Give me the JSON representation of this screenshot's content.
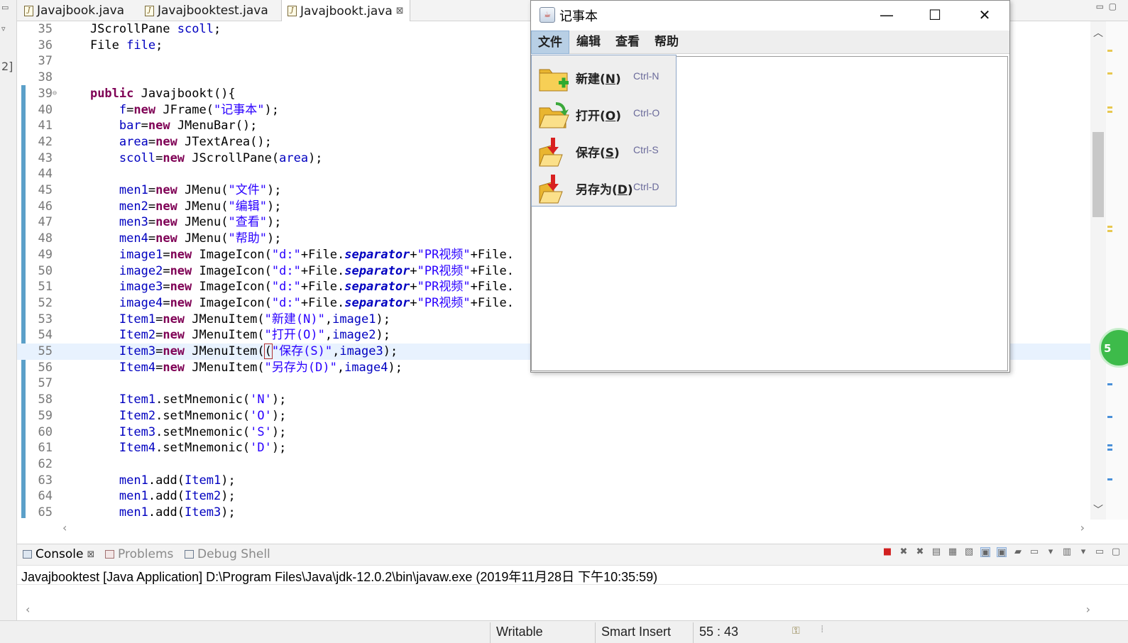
{
  "editor_tabs": [
    {
      "label": "Javajbook.java",
      "active": false
    },
    {
      "label": "Javajbooktest.java",
      "active": false
    },
    {
      "label": "Javajbookt.java",
      "active": true,
      "close": "⊠"
    }
  ],
  "left_strip": {
    "label": "2]"
  },
  "code_lines": [
    {
      "n": "35",
      "src": "    JScrollPane scoll;",
      "html": "    JScrollPane <span class=\"fld\">scoll</span>;"
    },
    {
      "n": "36",
      "src": "    File file;",
      "html": "    File <span class=\"fld\">file</span>;"
    },
    {
      "n": "37",
      "src": "",
      "html": ""
    },
    {
      "n": "38",
      "src": "",
      "html": ""
    },
    {
      "n": "39",
      "src": "    public Javajbookt(){",
      "html": "    <span class=\"kw\">public</span> Javajbookt(){",
      "fold": true
    },
    {
      "n": "40",
      "src": "        f=new JFrame(\"记事本\");",
      "html": "        <span class=\"fld\">f</span>=<span class=\"kw\">new</span> JFrame(<span class=\"str\">\"记事本\"</span>);"
    },
    {
      "n": "41",
      "src": "        bar=new JMenuBar();",
      "html": "        <span class=\"fld\">bar</span>=<span class=\"kw\">new</span> JMenuBar();"
    },
    {
      "n": "42",
      "src": "        area=new JTextArea();",
      "html": "        <span class=\"fld\">area</span>=<span class=\"kw\">new</span> JTextArea();"
    },
    {
      "n": "43",
      "src": "        scoll=new JScrollPane(area);",
      "html": "        <span class=\"fld\">scoll</span>=<span class=\"kw\">new</span> JScrollPane(<span class=\"fld\">area</span>);"
    },
    {
      "n": "44",
      "src": "",
      "html": ""
    },
    {
      "n": "45",
      "src": "        men1=new JMenu(\"文件\");",
      "html": "        <span class=\"fld\">men1</span>=<span class=\"kw\">new</span> JMenu(<span class=\"str\">\"文件\"</span>);"
    },
    {
      "n": "46",
      "src": "        men2=new JMenu(\"编辑\");",
      "html": "        <span class=\"fld\">men2</span>=<span class=\"kw\">new</span> JMenu(<span class=\"str\">\"编辑\"</span>);"
    },
    {
      "n": "47",
      "src": "        men3=new JMenu(\"查看\");",
      "html": "        <span class=\"fld\">men3</span>=<span class=\"kw\">new</span> JMenu(<span class=\"str\">\"查看\"</span>);"
    },
    {
      "n": "48",
      "src": "        men4=new JMenu(\"帮助\");",
      "html": "        <span class=\"fld\">men4</span>=<span class=\"kw\">new</span> JMenu(<span class=\"str\">\"帮助\"</span>);"
    },
    {
      "n": "49",
      "src": "        image1=new ImageIcon(\"d:\"+File.separator+\"PR视频\"+File.",
      "html": "        <span class=\"fld\">image1</span>=<span class=\"kw\">new</span> ImageIcon(<span class=\"str\">\"d:\"</span>+File.<span class=\"sfld\">separator</span>+<span class=\"str\">\"PR视频\"</span>+File."
    },
    {
      "n": "50",
      "src": "        image2=new ImageIcon(\"d:\"+File.separator+\"PR视频\"+File.",
      "html": "        <span class=\"fld\">image2</span>=<span class=\"kw\">new</span> ImageIcon(<span class=\"str\">\"d:\"</span>+File.<span class=\"sfld\">separator</span>+<span class=\"str\">\"PR视频\"</span>+File."
    },
    {
      "n": "51",
      "src": "        image3=new ImageIcon(\"d:\"+File.separator+\"PR视频\"+File.",
      "html": "        <span class=\"fld\">image3</span>=<span class=\"kw\">new</span> ImageIcon(<span class=\"str\">\"d:\"</span>+File.<span class=\"sfld\">separator</span>+<span class=\"str\">\"PR视频\"</span>+File."
    },
    {
      "n": "52",
      "src": "        image4=new ImageIcon(\"d:\"+File.separator+\"PR视频\"+File.",
      "html": "        <span class=\"fld\">image4</span>=<span class=\"kw\">new</span> ImageIcon(<span class=\"str\">\"d:\"</span>+File.<span class=\"sfld\">separator</span>+<span class=\"str\">\"PR视频\"</span>+File."
    },
    {
      "n": "53",
      "src": "        Item1=new JMenuItem(\"新建(N)\",image1);",
      "html": "        <span class=\"fld\">Item1</span>=<span class=\"kw\">new</span> JMenuItem(<span class=\"str\">\"新建(N)\"</span>,<span class=\"fld\">image1</span>);"
    },
    {
      "n": "54",
      "src": "        Item2=new JMenuItem(\"打开(O)\",image2);",
      "html": "        <span class=\"fld\">Item2</span>=<span class=\"kw\">new</span> JMenuItem(<span class=\"str\">\"打开(O)\"</span>,<span class=\"fld\">image2</span>);"
    },
    {
      "n": "55",
      "src": "        Item3=new JMenuItem(\"保存(S)\",image3);",
      "html": "        <span class=\"fld\">Item3</span>=<span class=\"kw\">new</span> JMenuItem(<span style=\"outline:1px solid #b03030\">(</span><span class=\"str\">\"保存(S)\"</span>,<span class=\"fld\">image3</span>);",
      "current": true
    },
    {
      "n": "56",
      "src": "        Item4=new JMenuItem(\"另存为(D)\",image4);",
      "html": "        <span class=\"fld\">Item4</span>=<span class=\"kw\">new</span> JMenuItem(<span class=\"str\">\"另存为(D)\"</span>,<span class=\"fld\">image4</span>);"
    },
    {
      "n": "57",
      "src": "",
      "html": ""
    },
    {
      "n": "58",
      "src": "        Item1.setMnemonic('N');",
      "html": "        <span class=\"fld\">Item1</span>.setMnemonic(<span class=\"str\">'N'</span>);"
    },
    {
      "n": "59",
      "src": "        Item2.setMnemonic('O');",
      "html": "        <span class=\"fld\">Item2</span>.setMnemonic(<span class=\"str\">'O'</span>);"
    },
    {
      "n": "60",
      "src": "        Item3.setMnemonic('S');",
      "html": "        <span class=\"fld\">Item3</span>.setMnemonic(<span class=\"str\">'S'</span>);"
    },
    {
      "n": "61",
      "src": "        Item4.setMnemonic('D');",
      "html": "        <span class=\"fld\">Item4</span>.setMnemonic(<span class=\"str\">'D'</span>);"
    },
    {
      "n": "62",
      "src": "",
      "html": ""
    },
    {
      "n": "63",
      "src": "        men1.add(Item1);",
      "html": "        <span class=\"fld\">men1</span>.add(<span class=\"fld\">Item1</span>);"
    },
    {
      "n": "64",
      "src": "        men1.add(Item2);",
      "html": "        <span class=\"fld\">men1</span>.add(<span class=\"fld\">Item2</span>);"
    },
    {
      "n": "65",
      "src": "        men1.add(Item3);",
      "html": "        <span class=\"fld\">men1</span>.add(<span class=\"fld\">Item3</span>);"
    }
  ],
  "swing_window": {
    "title": "记事本",
    "minimize": "—",
    "maximize": "☐",
    "close": "✕",
    "menus": [
      {
        "label": "文件",
        "open": true
      },
      {
        "label": "编辑"
      },
      {
        "label": "查看"
      },
      {
        "label": "帮助"
      }
    ],
    "file_menu_items": [
      {
        "label_html": "新建(<u>N</u>)",
        "label": "新建(N)",
        "accel": "Ctrl-N",
        "icon": "new-folder-icon"
      },
      {
        "label_html": "打开(<u>O</u>)",
        "label": "打开(O)",
        "accel": "Ctrl-O",
        "icon": "open-folder-icon"
      },
      {
        "label_html": "保存(<u>S</u>)",
        "label": "保存(S)",
        "accel": "Ctrl-S",
        "icon": "save-folder-icon"
      },
      {
        "label_html": "另存为(<u>D</u>)",
        "label": "另存为(D)",
        "accel": "Ctrl-D",
        "icon": "save-as-folder-icon"
      }
    ]
  },
  "badge": {
    "text": "5"
  },
  "console": {
    "tabs": [
      {
        "label": "Console",
        "active": true,
        "close": "⊠"
      },
      {
        "label": "Problems",
        "active": false
      },
      {
        "label": "Debug Shell",
        "active": false
      }
    ],
    "description": "Javajbooktest [Java Application] D:\\Program Files\\Java\\jdk-12.0.2\\bin\\javaw.exe (2019年11月28日 下午10:35:59)"
  },
  "statusbar": {
    "writable": "Writable",
    "insert_mode": "Smart Insert",
    "position": "55 : 43"
  },
  "colors": {
    "keyword": "#7f0055",
    "field": "#0000c0",
    "string": "#2a00ff",
    "current_line": "#e8f2fe",
    "menu_highlight": "#b8cfe5"
  }
}
